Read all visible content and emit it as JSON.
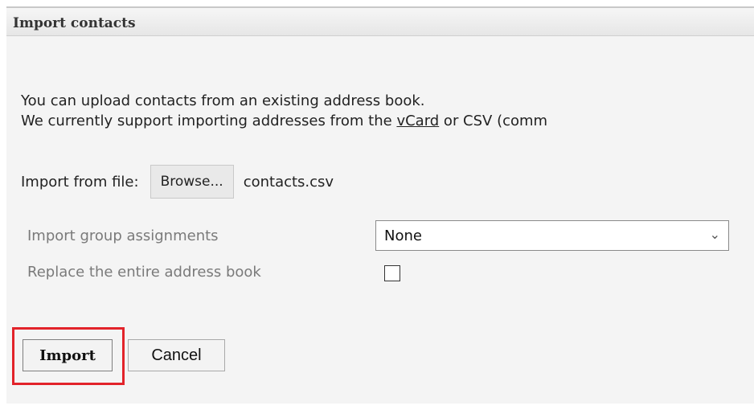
{
  "dialog": {
    "title": "Import contacts",
    "intro_line1": "You can upload contacts from an existing address book.",
    "intro_line2_before": "We currently support importing addresses from the ",
    "intro_link": "vCard",
    "intro_line2_after": " or CSV (comm",
    "file_label": "Import from file:",
    "browse_label": "Browse...",
    "file_name": "contacts.csv",
    "group_label": "Import group assignments",
    "group_value": "None",
    "replace_label": "Replace the entire address book",
    "replace_checked": false,
    "import_label": "Import",
    "cancel_label": "Cancel"
  },
  "icons": {
    "dropdown": "chevron-down-icon"
  },
  "colors": {
    "highlight": "#e2232a",
    "title_bar": "#e6e6e6",
    "muted_text": "#7a7a7a"
  }
}
